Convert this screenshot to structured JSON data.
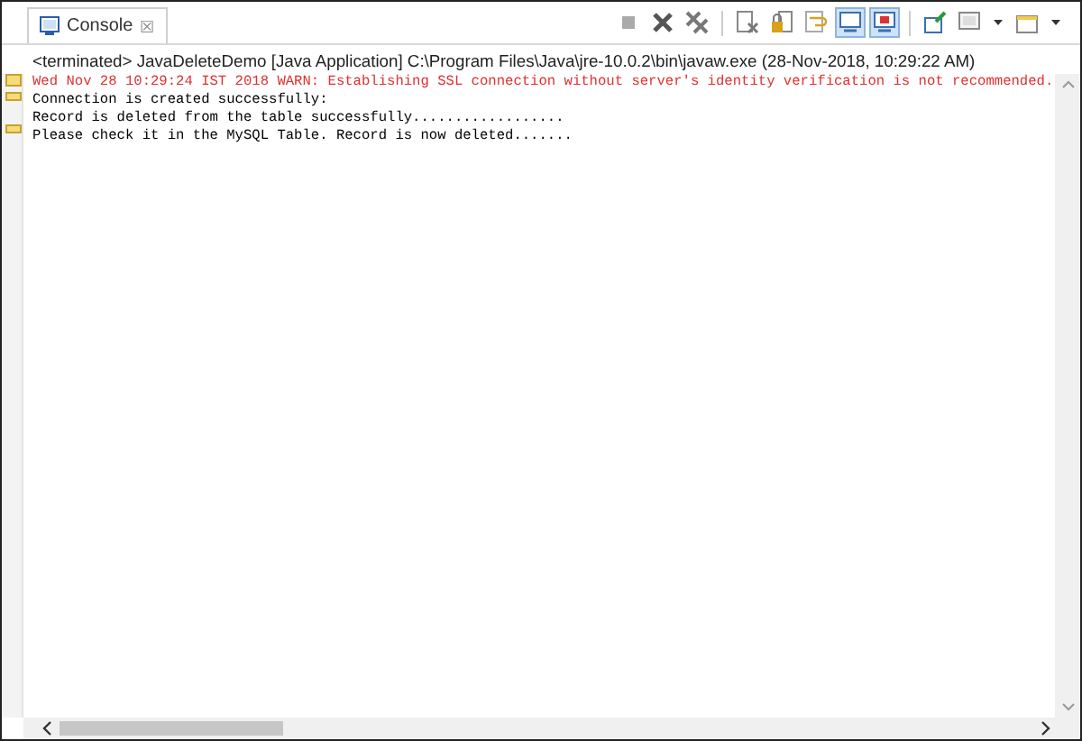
{
  "tab": {
    "label": "Console",
    "close": "☒",
    "selected": true
  },
  "toolbar": [
    {
      "kind": "stop",
      "on": false
    },
    {
      "kind": "remove",
      "on": false
    },
    {
      "kind": "remove-all",
      "on": false
    },
    {
      "kind": "clear",
      "on": false
    },
    {
      "kind": "scroll-lock",
      "on": false
    },
    {
      "kind": "word-wrap",
      "on": false
    },
    {
      "kind": "stdout",
      "on": true
    },
    {
      "kind": "stderr",
      "on": true
    },
    {
      "kind": "pin",
      "on": false
    },
    {
      "kind": "display",
      "on": false
    },
    {
      "kind": "open",
      "on": false
    }
  ],
  "header": "<terminated> JavaDeleteDemo [Java Application] C:\\Program Files\\Java\\jre-10.0.2\\bin\\javaw.exe (28-Nov-2018, 10:29:22 AM)",
  "lines": [
    {
      "kind": "stderr",
      "text": "Wed Nov 28 10:29:24 IST 2018 WARN: Establishing SSL connection without server's identity verification is not recommended."
    },
    {
      "kind": "stdout",
      "text": "Connection is created successfully:"
    },
    {
      "kind": "stdout",
      "text": "Record is deleted from the table successfully.................."
    },
    {
      "kind": "stdout",
      "text": "Please check it in the MySQL Table. Record is now deleted......."
    }
  ]
}
